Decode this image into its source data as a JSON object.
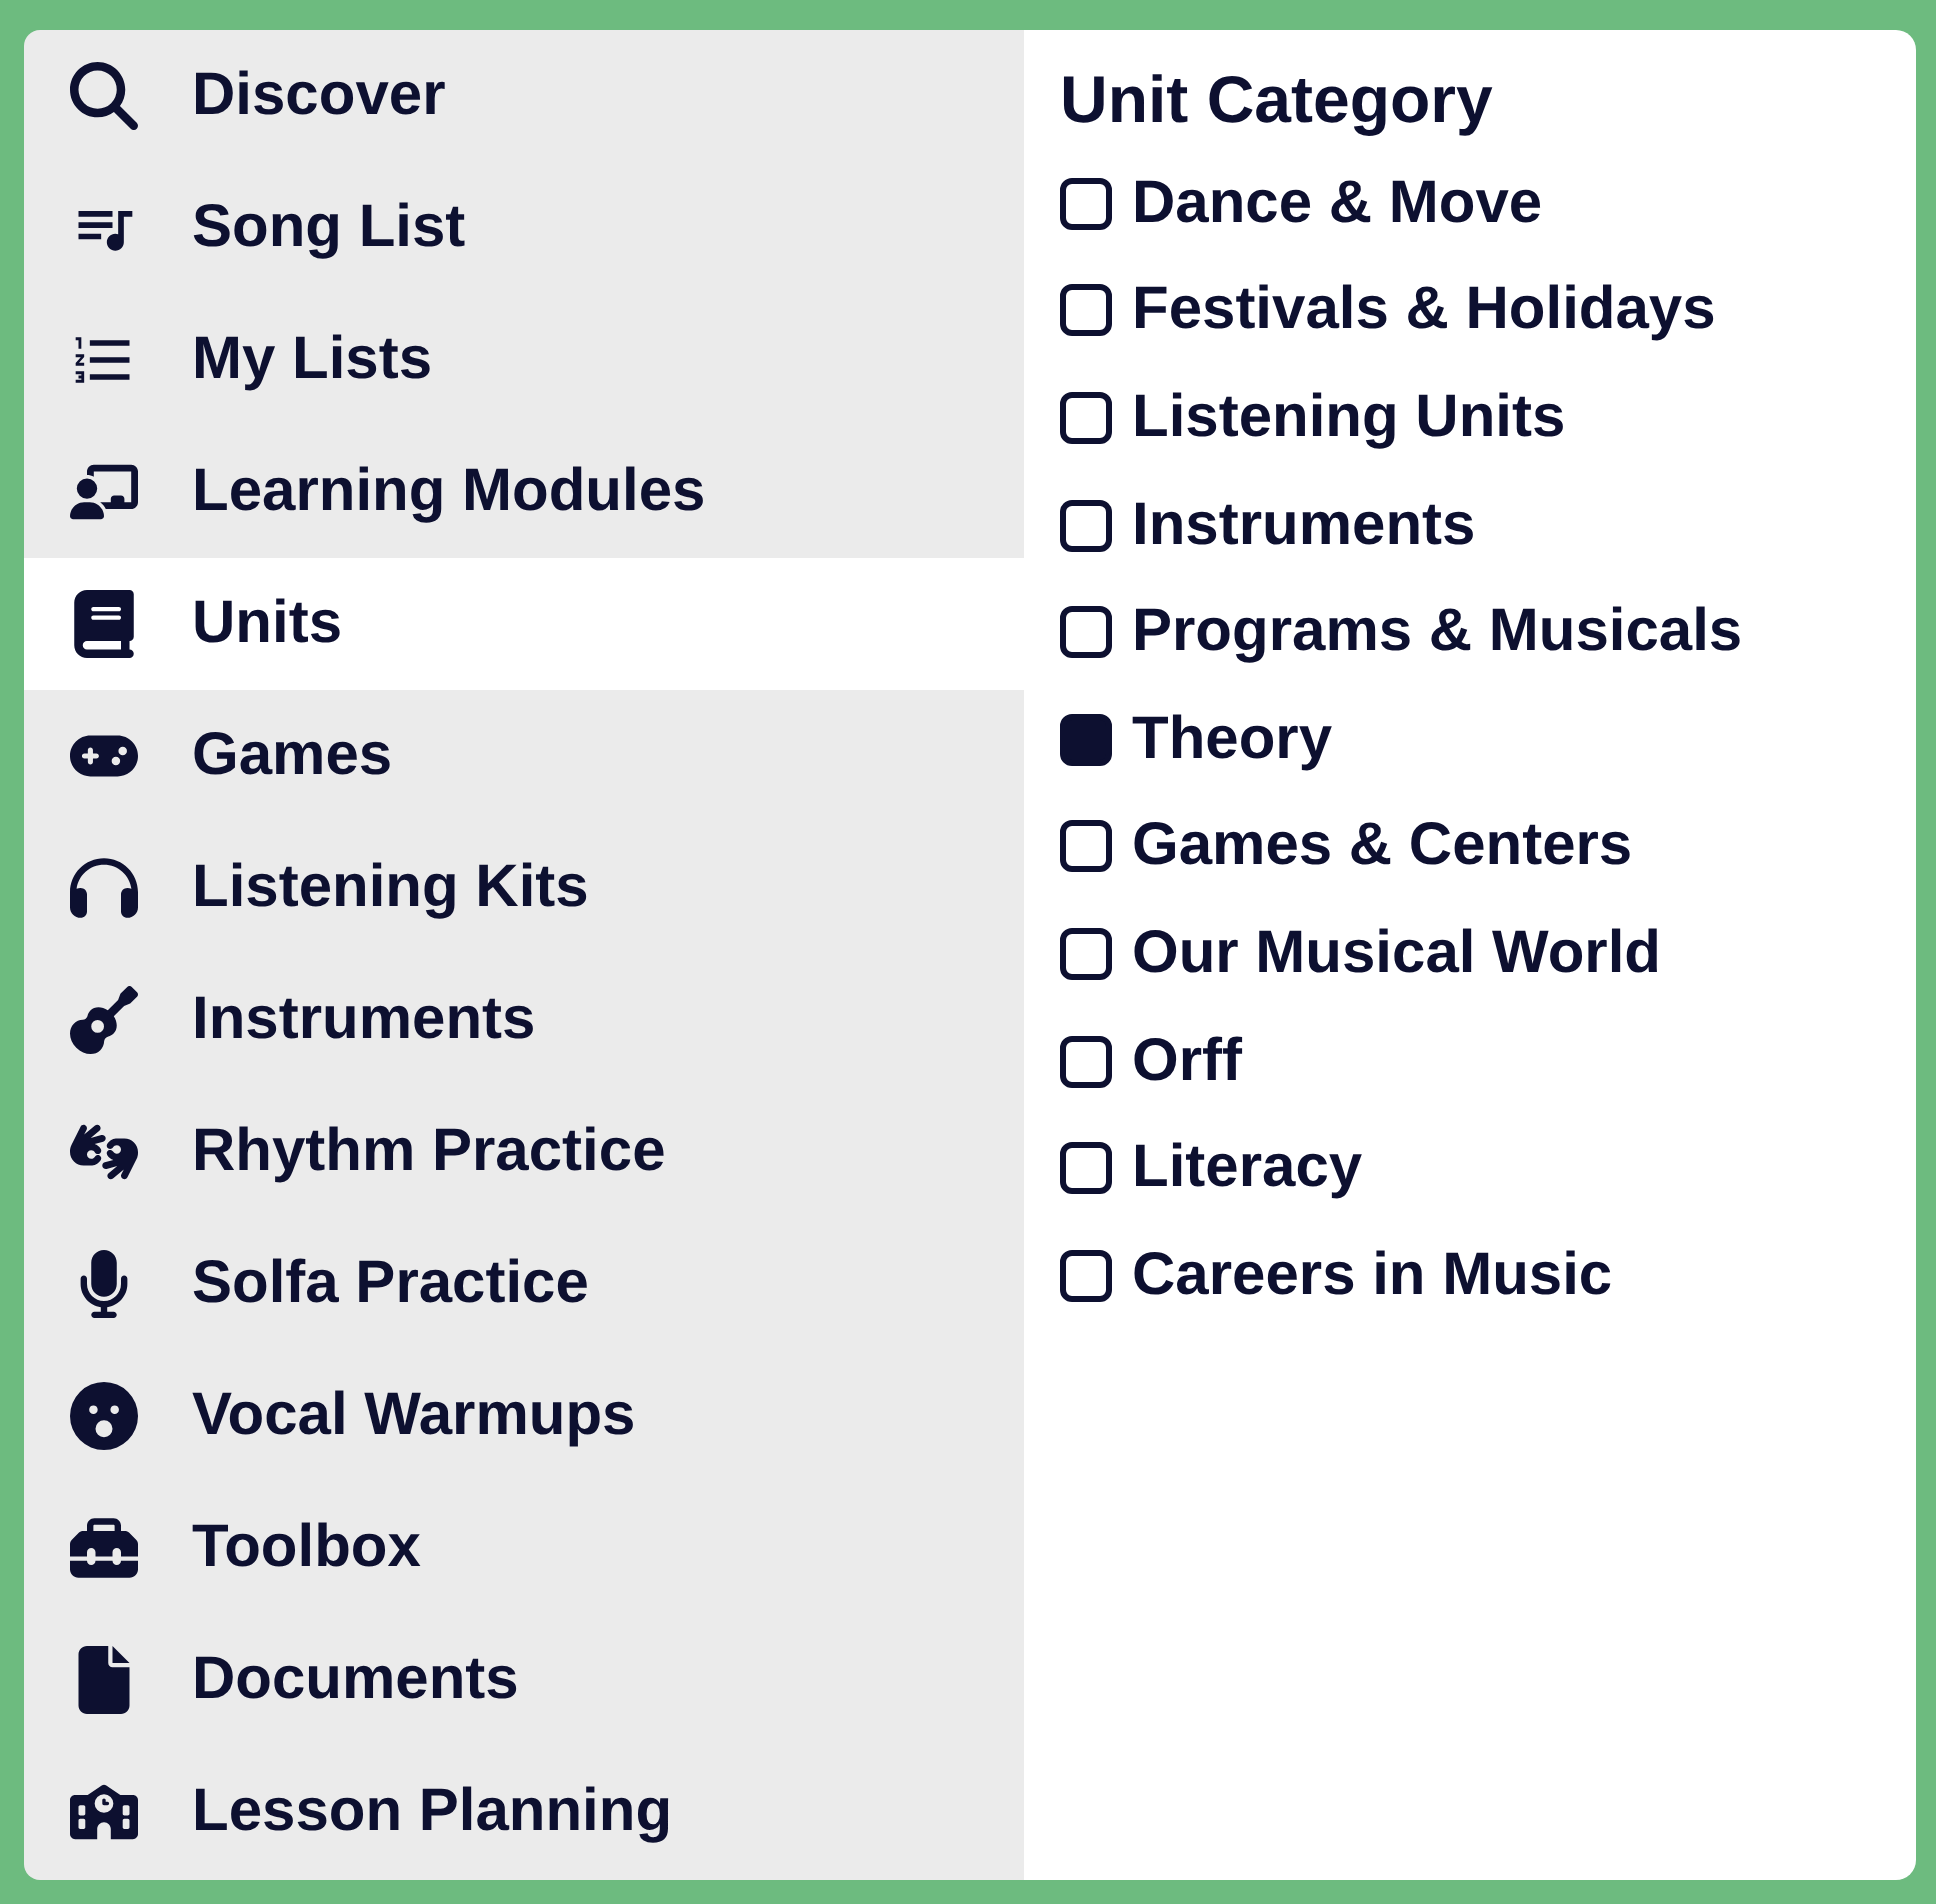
{
  "sidebar": {
    "items": [
      {
        "label": "Discover",
        "selected": false
      },
      {
        "label": "Song List",
        "selected": false
      },
      {
        "label": "My Lists",
        "selected": false
      },
      {
        "label": "Learning Modules",
        "selected": false
      },
      {
        "label": "Units",
        "selected": true
      },
      {
        "label": "Games",
        "selected": false
      },
      {
        "label": "Listening Kits",
        "selected": false
      },
      {
        "label": "Instruments",
        "selected": false
      },
      {
        "label": "Rhythm Practice",
        "selected": false
      },
      {
        "label": "Solfa Practice",
        "selected": false
      },
      {
        "label": "Vocal Warmups",
        "selected": false
      },
      {
        "label": "Toolbox",
        "selected": false
      },
      {
        "label": "Documents",
        "selected": false
      },
      {
        "label": "Lesson Planning",
        "selected": false
      }
    ]
  },
  "filter": {
    "title": "Unit Category",
    "options": [
      {
        "label": "Dance & Move",
        "checked": false
      },
      {
        "label": "Festivals & Holidays",
        "checked": false
      },
      {
        "label": "Listening Units",
        "checked": false
      },
      {
        "label": "Instruments",
        "checked": false
      },
      {
        "label": "Programs & Musicals",
        "checked": false
      },
      {
        "label": "Theory",
        "checked": true
      },
      {
        "label": "Games & Centers",
        "checked": false
      },
      {
        "label": "Our Musical World",
        "checked": false
      },
      {
        "label": "Orff",
        "checked": false
      },
      {
        "label": "Literacy",
        "checked": false
      },
      {
        "label": "Careers in Music",
        "checked": false
      }
    ]
  }
}
